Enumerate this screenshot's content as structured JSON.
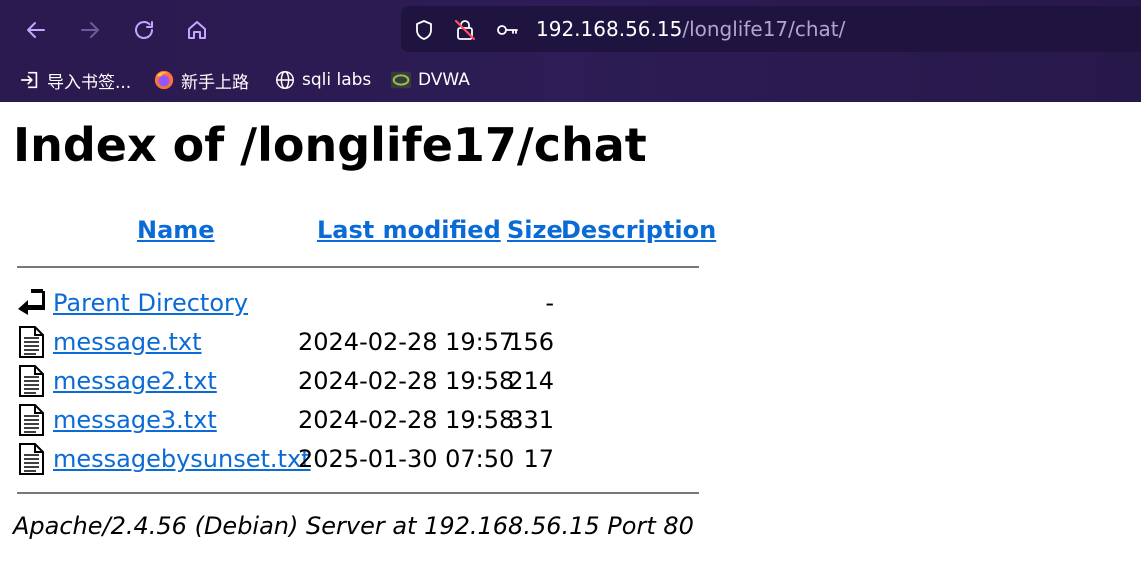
{
  "browser": {
    "url_host": "192.168.56.15",
    "url_path": "/longlife17/chat/",
    "nav": {
      "back_icon": "arrow-left-icon",
      "forward_icon": "arrow-right-icon",
      "reload_icon": "reload-icon",
      "home_icon": "home-icon"
    },
    "bookmarks": [
      {
        "label": "导入书签...",
        "icon": "import-icon"
      },
      {
        "label": "新手上路",
        "icon": "firefox-icon"
      },
      {
        "label": "sqli labs",
        "icon": "globe-icon"
      },
      {
        "label": "DVWA",
        "icon": "dvwa-icon"
      }
    ],
    "colors": {
      "chrome_bg": "#2a1a4f",
      "url_bg": "#1f1440",
      "accent": "#c3a6ff"
    }
  },
  "page": {
    "title": "Index of /longlife17/chat",
    "columns": {
      "name": "Name",
      "last_modified": "Last modified",
      "size": "Size",
      "description": "Description"
    },
    "rows": [
      {
        "name": "Parent Directory",
        "modified": "",
        "size": "-",
        "icon": "back-folder-icon"
      },
      {
        "name": "message.txt",
        "modified": "2024-02-28 19:57",
        "size": "156",
        "icon": "text-file-icon"
      },
      {
        "name": "message2.txt",
        "modified": "2024-02-28 19:58",
        "size": "214",
        "icon": "text-file-icon"
      },
      {
        "name": "message3.txt",
        "modified": "2024-02-28 19:58",
        "size": "331",
        "icon": "text-file-icon"
      },
      {
        "name": "messagebysunset.txt",
        "modified": "2025-01-30 07:50",
        "size": "17",
        "icon": "text-file-icon"
      }
    ],
    "address": "Apache/2.4.56 (Debian) Server at 192.168.56.15 Port 80",
    "link_color": "#0b6bd6"
  }
}
